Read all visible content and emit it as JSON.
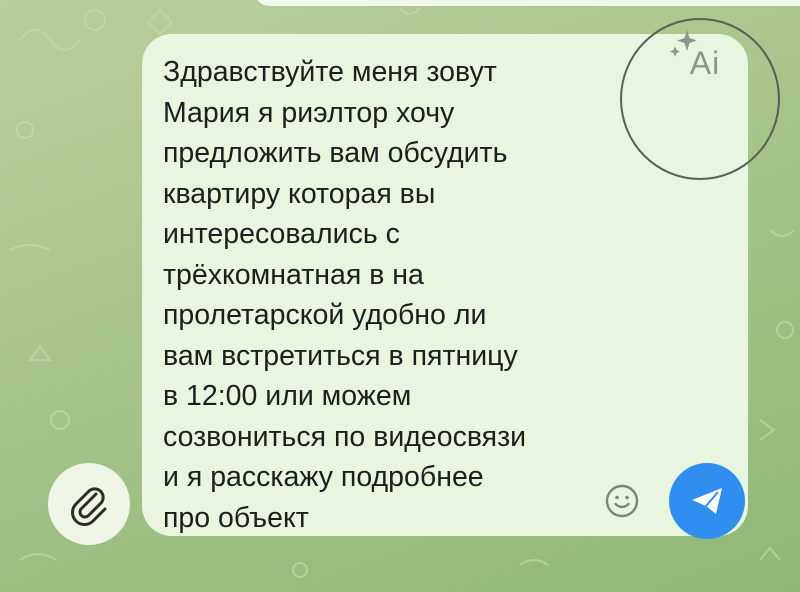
{
  "composer": {
    "message_lines": [
      "Здравствуйте меня зовут",
      "Мария я риэлтор хочу",
      "предложить вам обсудить",
      "квартиру которая вы",
      "интересовались с",
      "трёхкомнатная в на",
      "пролетарской удобно ли",
      "вам встретиться в пятницу",
      "в 12:00 или можем",
      "созвониться по видеосвязи",
      "и я расскажу подробнее",
      "про объект"
    ],
    "ai_label": "Ai"
  },
  "icons": {
    "attach": "paperclip-icon",
    "ai": "sparkle-ai-icon",
    "emoji": "smiley-icon",
    "send": "paper-plane-icon"
  },
  "colors": {
    "background": "#a9c58d",
    "composer": "#eaf5e0",
    "send_button": "#2f8ef0",
    "highlight_circle": "#5a5f55"
  }
}
